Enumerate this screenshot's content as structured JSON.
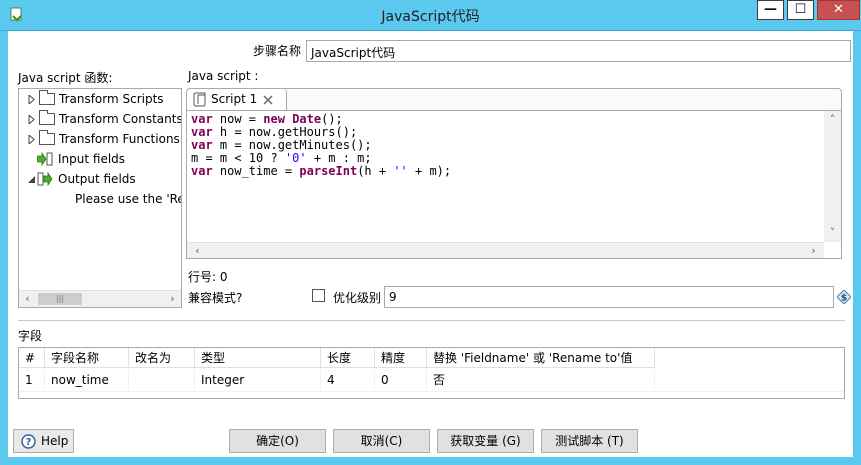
{
  "window": {
    "title": "JavaScript代码",
    "minimize": "—",
    "maximize": "☐",
    "close": "✕"
  },
  "step_name": {
    "label": "步骤名称",
    "value": "JavaScript代码"
  },
  "functions_panel": {
    "label": "Java script 函数:",
    "items": [
      {
        "label": "Transform Scripts"
      },
      {
        "label": "Transform Constants"
      },
      {
        "label": "Transform Functions"
      },
      {
        "label": "Input fields"
      },
      {
        "label": "Output fields"
      },
      {
        "label": "Please use the 'Rep"
      }
    ]
  },
  "script_panel": {
    "label": "Java script :",
    "tab_label": "Script 1",
    "code_lines": [
      "var now = new Date();",
      "var h = now.getHours();",
      "var m = now.getMinutes();",
      "m = m < 10 ? '0' + m : m;",
      "var now_time = parseInt(h + '' + m);"
    ]
  },
  "line_number": {
    "label": "行号: 0"
  },
  "compat": {
    "label": "兼容模式?"
  },
  "optimization": {
    "label": "优化级别",
    "value": "9"
  },
  "fields": {
    "label": "字段",
    "columns": [
      "#",
      "字段名称",
      "改名为",
      "类型",
      "长度",
      "精度",
      "替换 'Fieldname' 或 'Rename to'值"
    ],
    "rows": [
      [
        "1",
        "now_time",
        "",
        "Integer",
        "4",
        "0",
        "否"
      ]
    ]
  },
  "buttons": {
    "help": "Help",
    "ok": "确定(O)",
    "cancel": "取消(C)",
    "get_vars": "获取变量 (G)",
    "test_script": "测试脚本 (T)"
  },
  "colors": {
    "titlebar": "#5bc8ef",
    "keyword": "#7f0055",
    "string": "#2a00ff",
    "close_button": "#c75050"
  }
}
